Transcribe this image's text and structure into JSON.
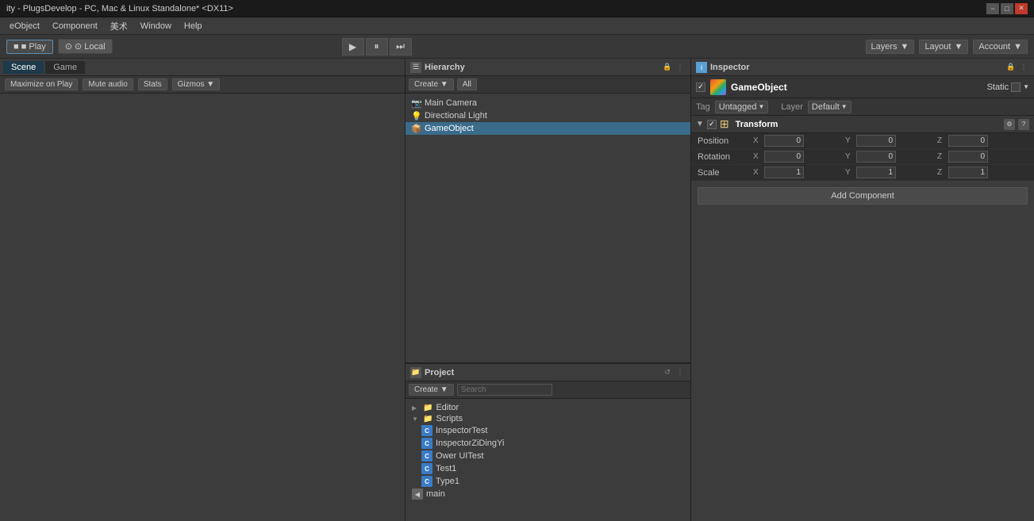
{
  "window": {
    "title": "ity - PlugsDevelop - PC, Mac & Linux Standalone* <DX11>"
  },
  "menu": {
    "items": [
      "eObject",
      "Component",
      "美术",
      "Window",
      "Help"
    ]
  },
  "toolbar": {
    "play_label": "▶",
    "pause_label": "⏸",
    "step_label": "⏭",
    "scene_tab": "■ Play",
    "local_tab": "⊙ Local",
    "layers_label": "Layers",
    "layout_label": "Layout",
    "account_label": "Account"
  },
  "scene_view": {
    "tabs": [
      "Scene",
      "Game"
    ],
    "toolbar": {
      "maximize": "Maximize on Play",
      "mute": "Mute audio",
      "stats": "Stats",
      "gizmos": "Gizmos ▼"
    }
  },
  "hierarchy": {
    "title": "Hierarchy",
    "create_label": "Create ▼",
    "all_label": "All",
    "items": [
      {
        "name": "Main Camera",
        "selected": false,
        "indent": 0
      },
      {
        "name": "Directional Light",
        "selected": false,
        "indent": 0
      },
      {
        "name": "GameObject",
        "selected": true,
        "indent": 0
      }
    ]
  },
  "inspector": {
    "title": "Inspector",
    "object_name": "GameObject",
    "static_label": "Static",
    "static_checked": false,
    "tag_label": "Tag",
    "tag_value": "Untagged",
    "layer_label": "Layer",
    "layer_value": "Default",
    "transform": {
      "component_name": "Transform",
      "position": {
        "x": "0",
        "y": "0",
        "z": "0"
      },
      "rotation": {
        "x": "0",
        "y": "0",
        "z": "0"
      },
      "scale": {
        "x": "1",
        "y": "1",
        "z": "1"
      }
    },
    "add_component_label": "Add Component"
  },
  "project": {
    "title": "Project",
    "create_label": "Create ▼",
    "search_placeholder": "Search",
    "tree": [
      {
        "name": "Editor",
        "type": "folder",
        "indent": 0,
        "expanded": false
      },
      {
        "name": "Scripts",
        "type": "folder",
        "indent": 0,
        "expanded": true
      },
      {
        "name": "InspectorTest",
        "type": "script",
        "indent": 1
      },
      {
        "name": "InspectorZiDingYi",
        "type": "script",
        "indent": 1
      },
      {
        "name": "Ower UITest",
        "type": "script",
        "indent": 1
      },
      {
        "name": "Test1",
        "type": "script",
        "indent": 1
      },
      {
        "name": "Type1",
        "type": "script",
        "indent": 1
      },
      {
        "name": "main",
        "type": "scene",
        "indent": 0
      }
    ]
  },
  "colors": {
    "selected_bg": "#3a6b8a",
    "header_bg": "#3c3c3c",
    "panel_bg": "#2d2d2d",
    "toolbar_bg": "#383838",
    "accent_blue": "#3a7bc8"
  }
}
